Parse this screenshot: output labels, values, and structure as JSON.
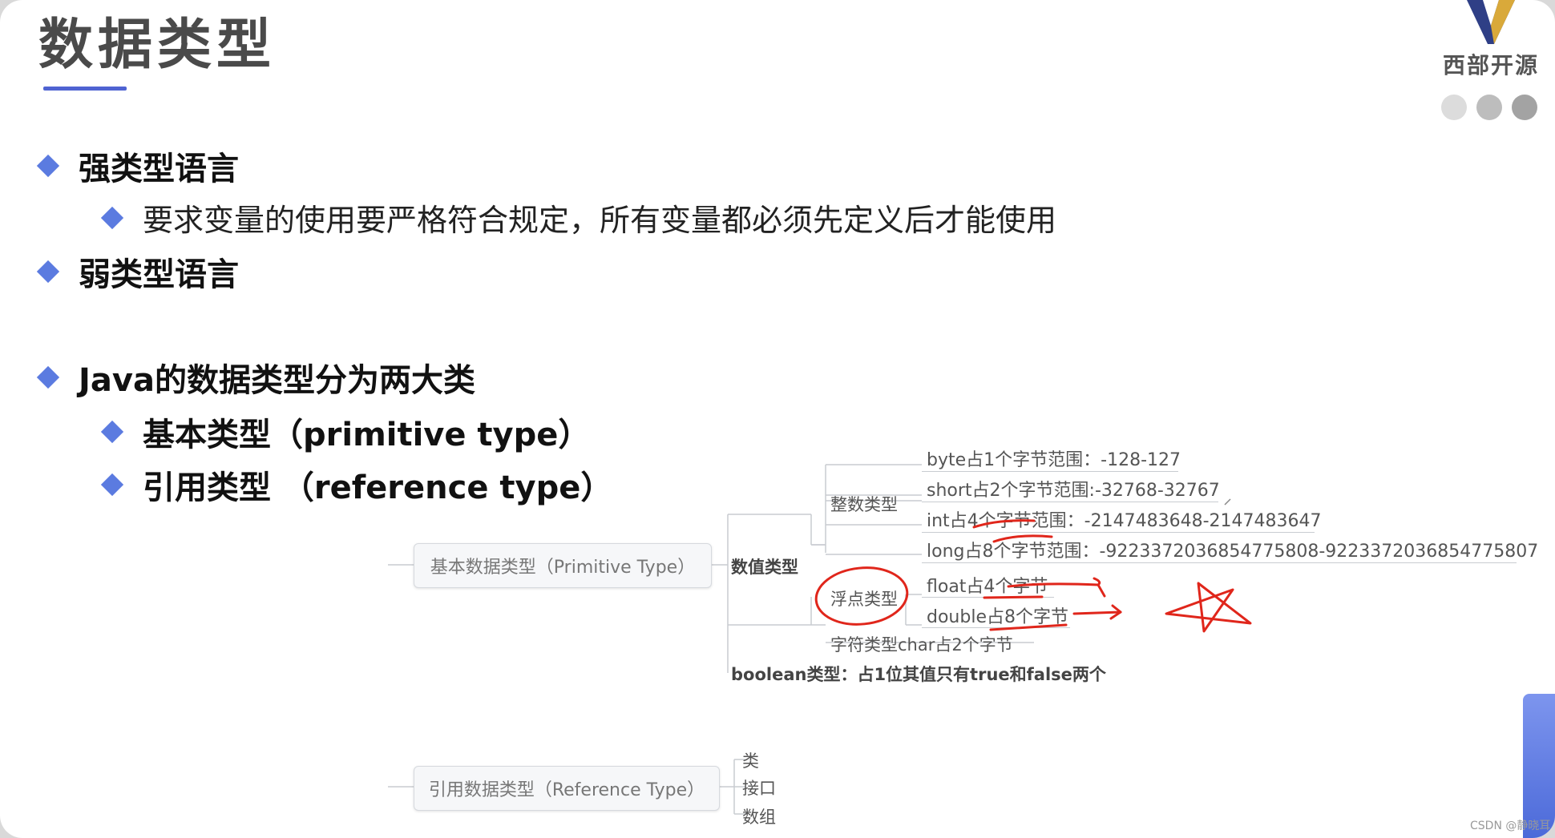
{
  "slide": {
    "title": "数据类型",
    "logo_text": "西部开源",
    "accent_color": "#5b7be0",
    "dots": [
      "#dcdcdc",
      "#bdbdbd",
      "#a3a3a3"
    ]
  },
  "bullets": {
    "strong": "强类型语言",
    "strong_sub": "要求变量的使用要严格符合规定，所有变量都必须先定义后才能使用",
    "weak": "弱类型语言",
    "java_types": "Java的数据类型分为两大类",
    "primitive": "基本类型（primitive type）",
    "reference": "引用类型 （reference type）"
  },
  "mindmap": {
    "primitive_root": "基本数据类型（Primitive Type）",
    "numeric": "数值类型",
    "integer": "整数类型",
    "integer_items": [
      "byte占1个字节范围：-128-127",
      "short占2个字节范围:-32768-32767",
      "int占4个字节范围：-2147483648-2147483647",
      "long占8个字节范围：-9223372036854775808-9223372036854775807"
    ],
    "float": "浮点类型",
    "float_items": [
      "float占4个字节",
      "double占8个字节"
    ],
    "char": "字符类型char占2个字节",
    "boolean": "boolean类型：占1位其值只有true和false两个",
    "reference_root": "引用数据类型（Reference Type）",
    "reference_items": [
      "类",
      "接口",
      "数组"
    ]
  },
  "annotation_color": "#e0261b",
  "watermark": "CSDN @静晓耳"
}
